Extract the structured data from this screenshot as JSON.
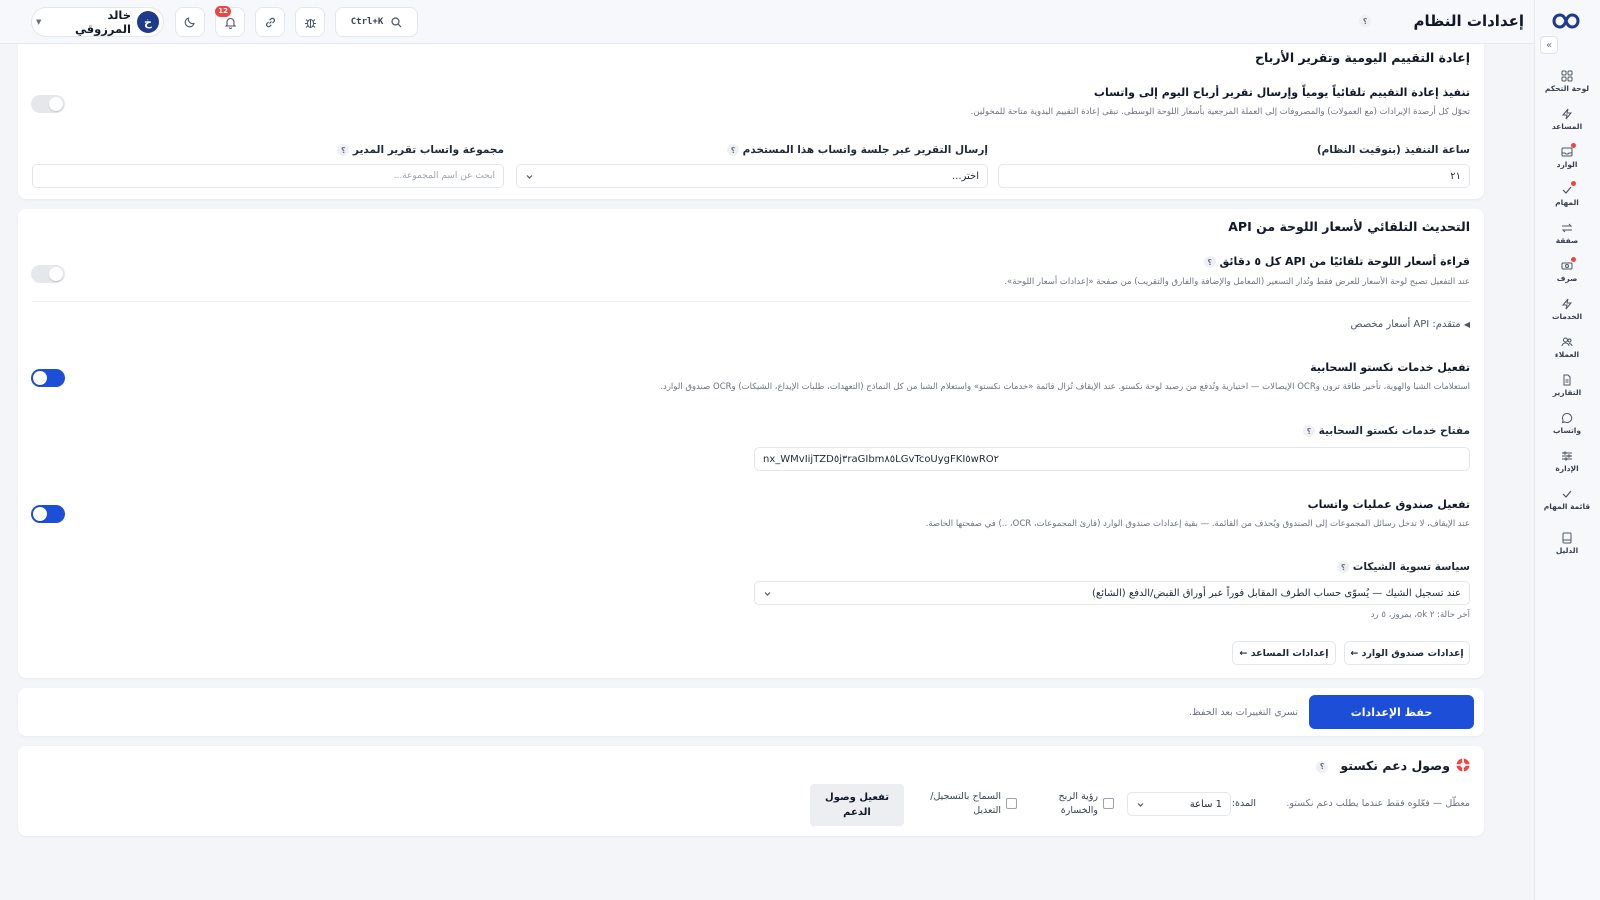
{
  "header": {
    "title": "إعدادات النظام",
    "help_mark": "؟",
    "search_shortcut": "Ctrl+K",
    "notification_count": "12",
    "user_initial": "خ",
    "user_name": "خالد المرزوقي"
  },
  "sidebar": {
    "items": [
      {
        "label": "لوحة التحكم",
        "icon": "grid-icon"
      },
      {
        "label": "المساعد",
        "icon": "bolt-icon"
      },
      {
        "label": "الوارد",
        "icon": "inbox-icon",
        "dot": true
      },
      {
        "label": "المهام",
        "icon": "check-icon",
        "dot": true
      },
      {
        "label": "صفقة",
        "icon": "swap-icon"
      },
      {
        "label": "صرف",
        "icon": "cash-icon",
        "dot": true
      },
      {
        "label": "الخدمات",
        "icon": "bolt-icon"
      },
      {
        "label": "العملاء",
        "icon": "users-icon"
      },
      {
        "label": "التقارير",
        "icon": "document-icon"
      },
      {
        "label": "واتساب",
        "icon": "chat-icon"
      },
      {
        "label": "الإدارة",
        "icon": "sliders-icon"
      },
      {
        "label": "قائمة المهام",
        "icon": "check-icon"
      },
      {
        "label": "الدليل",
        "icon": "book-icon"
      }
    ]
  },
  "daily": {
    "section_title": "إعادة التقييم اليومية وتقرير الأرباح",
    "row_title": "تنفيذ إعادة التقييم تلقائياً يومياً وإرسال تقرير أرباح اليوم إلى واتساب",
    "row_desc": "تحوّل كل أرصدة الإيرادات (مع العمولات) والمصروفات إلى العملة المرجعية بأسعار اللوحة الوسطى. تبقى إعادة التقييم اليدوية متاحة للمخولين.",
    "enabled": false,
    "exec_hour_label": "ساعة التنفيذ (بتوقيت النظام)",
    "exec_hour_value": "٢١",
    "session_label": "إرسال التقرير عبر جلسة واتساب هذا المستخدم",
    "session_value": "اختر...",
    "group_label": "مجموعة واتساب تقرير المدير",
    "group_placeholder": "ابحث عن اسم المجموعة..."
  },
  "api": {
    "section_title": "التحديث التلقائي لأسعار اللوحة من API",
    "auto_title": "قراءة أسعار اللوحة تلقائيًا من API كل ٥ دقائق",
    "auto_desc": "عند التفعيل تصبح لوحة الأسعار للعرض فقط وتُدار التسعير (المعامل والإضافة والفارق والتقريب) من صفحة «إعدادات أسعار اللوحة».",
    "auto_enabled": false,
    "advanced_label": "متقدم: API أسعار مخصص",
    "cloud_title": "تفعيل خدمات نكستو السحابية",
    "cloud_desc": "استعلامات الشبا والهوية، تأخير طاقة ترون وOCR الإيصالات — اختيارية وتُدفع من رصيد لوحة نكستو. عند الإيقاف تُزال قائمة «خدمات نكستو» واستعلام الشبا من كل النماذج (التعهدات، طلبات الإيداع، الشيكات) وOCR صندوق الوارد.",
    "cloud_enabled": true,
    "key_label": "مفتاح خدمات نكستو السحابية",
    "key_value": "nx_WMvIijTZD٥j٣raGIbm٨٥LGvTcoUygFKI٥wRO٢",
    "wa_title": "تفعيل صندوق عمليات واتساب",
    "wa_desc": "عند الإيقاف، لا تدخل رسائل المجموعات إلى الصندوق ويُحذف من القائمة. — بقية إعدادات صندوق الوارد (قارئ المجموعات، OCR، ..) في صفحتها الخاصة.",
    "wa_enabled": true,
    "cheque_label": "سياسة تسوية الشيكات",
    "cheque_value": "عند تسجيل الشيك — يُسوّى حساب الطرف المقابل فوراً عبر أوراق القبض/الدفع (الشائع)",
    "cheque_status": "آخر حالة: ٢ ok، بمروز، ٥ رد",
    "inbox_settings_btn": "إعدادات صندوق الوارد ←",
    "assistant_settings_btn": "إعدادات المساعد ←"
  },
  "save": {
    "button": "حفظ الإعدادات",
    "note": "تسري التغييرات بعد الحفظ."
  },
  "support": {
    "title": "وصول دعم نكستو",
    "desc": "معطّل — فعّلوه فقط عندما يطلب دعم نكستو.",
    "duration_label": "المدة:",
    "duration_value": "1 ساعة",
    "pnl_label": "رؤية الربح والخسارة",
    "edit_label": "السماح بالتسجيل/التعديل",
    "enable_btn": "تفعيل وصول الدعم"
  }
}
